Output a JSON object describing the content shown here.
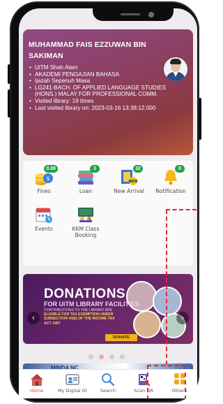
{
  "profile": {
    "name": "MUHAMMAD FAIS EZZUWAN BIN SAKIMAN",
    "details": [
      "UiTM Shah Alam",
      "AKADEMI PENGAJIAN BAHASA",
      "Ijazah Sepenuh Masa",
      "LG241-BACH. OF APPLIED LANGUAGE STUDIES (HONS.) MALAY FOR PROFESSIONAL COMM.",
      "Visited library: 19 times",
      "Last visited library on: 2023-03-16 13:38:12.000"
    ]
  },
  "menu": {
    "items": [
      {
        "label": "Fines",
        "badge": "0.00",
        "icon": "coins-icon"
      },
      {
        "label": "Loan",
        "badge": "3",
        "icon": "books-icon"
      },
      {
        "label": "New Arrival",
        "badge": "32",
        "icon": "new-arrival-icon"
      },
      {
        "label": "Notification",
        "badge": "0",
        "icon": "bell-icon"
      },
      {
        "label": "Events",
        "icon": "calendar-icon"
      },
      {
        "label": "KKM Class Booking",
        "icon": "classroom-icon"
      }
    ]
  },
  "banner": {
    "title": "DONATIONS",
    "subtitle": "FOR UiTM LIBRARY FACILITIES",
    "fine_print_lead": "CONTRIBUTIONS TO THE LIBRARY ARE",
    "fine_print_highlight": "ELIGIBLE FOR TAX EXEMPTION UNDER SUBSECTION 44(6) OF THE INCOME TAX ACT 1967",
    "button": "DONATE",
    "page_count": 4,
    "active_page": 1
  },
  "peek_card": {
    "text": "MINDA NC"
  },
  "bottom_nav": [
    {
      "label": "Home",
      "icon": "home-icon"
    },
    {
      "label": "My Digital ID",
      "icon": "digital-id-icon"
    },
    {
      "label": "Search",
      "icon": "search-icon"
    },
    {
      "label": "Scan QR",
      "icon": "scan-qr-icon"
    },
    {
      "label": "Others",
      "icon": "grid-icon"
    }
  ],
  "colors": {
    "accent": "#d23a50",
    "badge": "#23a14b",
    "highlight": "#e5262e"
  }
}
